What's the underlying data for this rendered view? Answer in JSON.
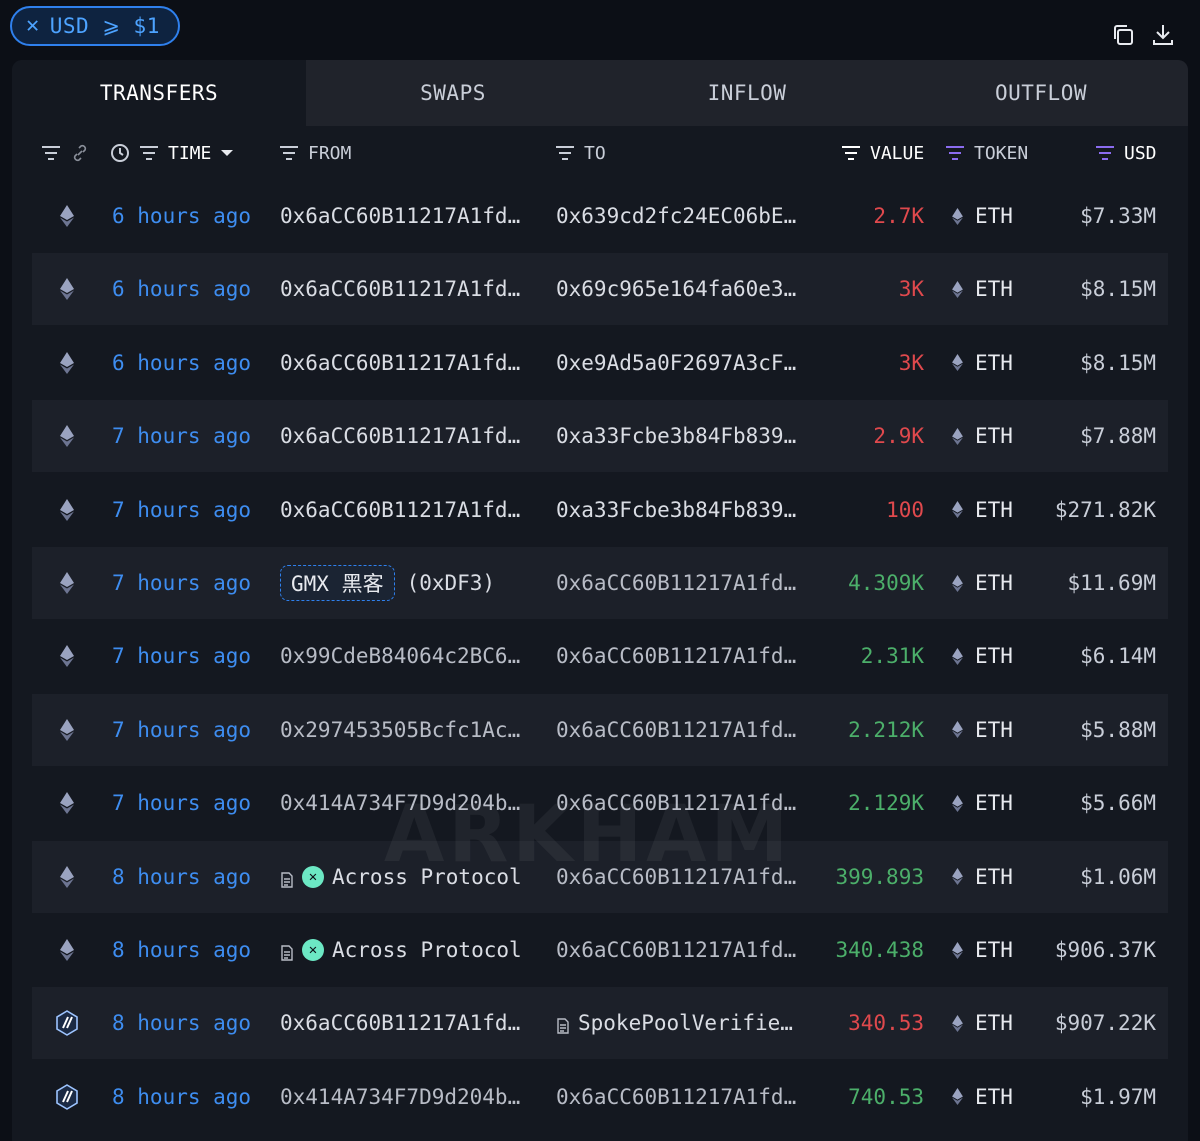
{
  "filter": {
    "label": "USD ⩾ $1"
  },
  "tabs": [
    "TRANSFERS",
    "SWAPS",
    "INFLOW",
    "OUTFLOW"
  ],
  "columns": {
    "time": "TIME",
    "from": "FROM",
    "to": "TO",
    "value": "VALUE",
    "token": "TOKEN",
    "usd": "USD"
  },
  "watermark": "ARKHAM",
  "colors": {
    "accent": "#2f80ed",
    "time_link": "#3e8df0",
    "negative": "#e0494d",
    "positive": "#4caf6a",
    "row_alt": "#1c2029"
  },
  "rows": [
    {
      "chain": "ethereum-icon",
      "time": "6 hours ago",
      "from": "0x6aCC60B11217A1fd…",
      "to": "0x639cd2fc24EC06bE…",
      "value": "2.7K",
      "dir": "out",
      "token": "ETH",
      "usd": "$7.33M"
    },
    {
      "chain": "ethereum-icon",
      "time": "6 hours ago",
      "from": "0x6aCC60B11217A1fd…",
      "to": "0x69c965e164fa60e3…",
      "value": "3K",
      "dir": "out",
      "token": "ETH",
      "usd": "$8.15M"
    },
    {
      "chain": "ethereum-icon",
      "time": "6 hours ago",
      "from": "0x6aCC60B11217A1fd…",
      "to": "0xe9Ad5a0F2697A3cF…",
      "value": "3K",
      "dir": "out",
      "token": "ETH",
      "usd": "$8.15M"
    },
    {
      "chain": "ethereum-icon",
      "time": "7 hours ago",
      "from": "0x6aCC60B11217A1fd…",
      "to": "0xa33Fcbe3b84Fb839…",
      "value": "2.9K",
      "dir": "out",
      "token": "ETH",
      "usd": "$7.88M"
    },
    {
      "chain": "ethereum-icon",
      "time": "7 hours ago",
      "from": "0x6aCC60B11217A1fd…",
      "to": "0xa33Fcbe3b84Fb839…",
      "value": "100",
      "dir": "out",
      "token": "ETH",
      "usd": "$271.82K"
    },
    {
      "chain": "ethereum-icon",
      "time": "7 hours ago",
      "from_entity": "GMX 黑客",
      "from_suffix": "(0xDF3)",
      "to": "0x6aCC60B11217A1fd…",
      "value": "4.309K",
      "dir": "in",
      "token": "ETH",
      "usd": "$11.69M"
    },
    {
      "chain": "ethereum-icon",
      "time": "7 hours ago",
      "from": "0x99CdeB84064c2BC6…",
      "to": "0x6aCC60B11217A1fd…",
      "value": "2.31K",
      "dir": "in",
      "token": "ETH",
      "usd": "$6.14M"
    },
    {
      "chain": "ethereum-icon",
      "time": "7 hours ago",
      "from": "0x297453505Bcfc1Ac…",
      "to": "0x6aCC60B11217A1fd…",
      "value": "2.212K",
      "dir": "in",
      "token": "ETH",
      "usd": "$5.88M"
    },
    {
      "chain": "ethereum-icon",
      "time": "7 hours ago",
      "from": "0x414A734F7D9d204b…",
      "to": "0x6aCC60B11217A1fd…",
      "value": "2.129K",
      "dir": "in",
      "token": "ETH",
      "usd": "$5.66M"
    },
    {
      "chain": "ethereum-icon",
      "time": "8 hours ago",
      "from_protocol": "Across Protocol",
      "to": "0x6aCC60B11217A1fd…",
      "value": "399.893",
      "dir": "in",
      "token": "ETH",
      "usd": "$1.06M"
    },
    {
      "chain": "ethereum-icon",
      "time": "8 hours ago",
      "from_protocol": "Across Protocol",
      "to": "0x6aCC60B11217A1fd…",
      "value": "340.438",
      "dir": "in",
      "token": "ETH",
      "usd": "$906.37K"
    },
    {
      "chain": "arbitrum-icon",
      "time": "8 hours ago",
      "from": "0x6aCC60B11217A1fd…",
      "to_contract": "SpokePoolVerifie…",
      "value": "340.53",
      "dir": "out",
      "token": "ETH",
      "usd": "$907.22K"
    },
    {
      "chain": "arbitrum-icon",
      "time": "8 hours ago",
      "from": "0x414A734F7D9d204b…",
      "to": "0x6aCC60B11217A1fd…",
      "value": "740.53",
      "dir": "in",
      "token": "ETH",
      "usd": "$1.97M"
    }
  ]
}
